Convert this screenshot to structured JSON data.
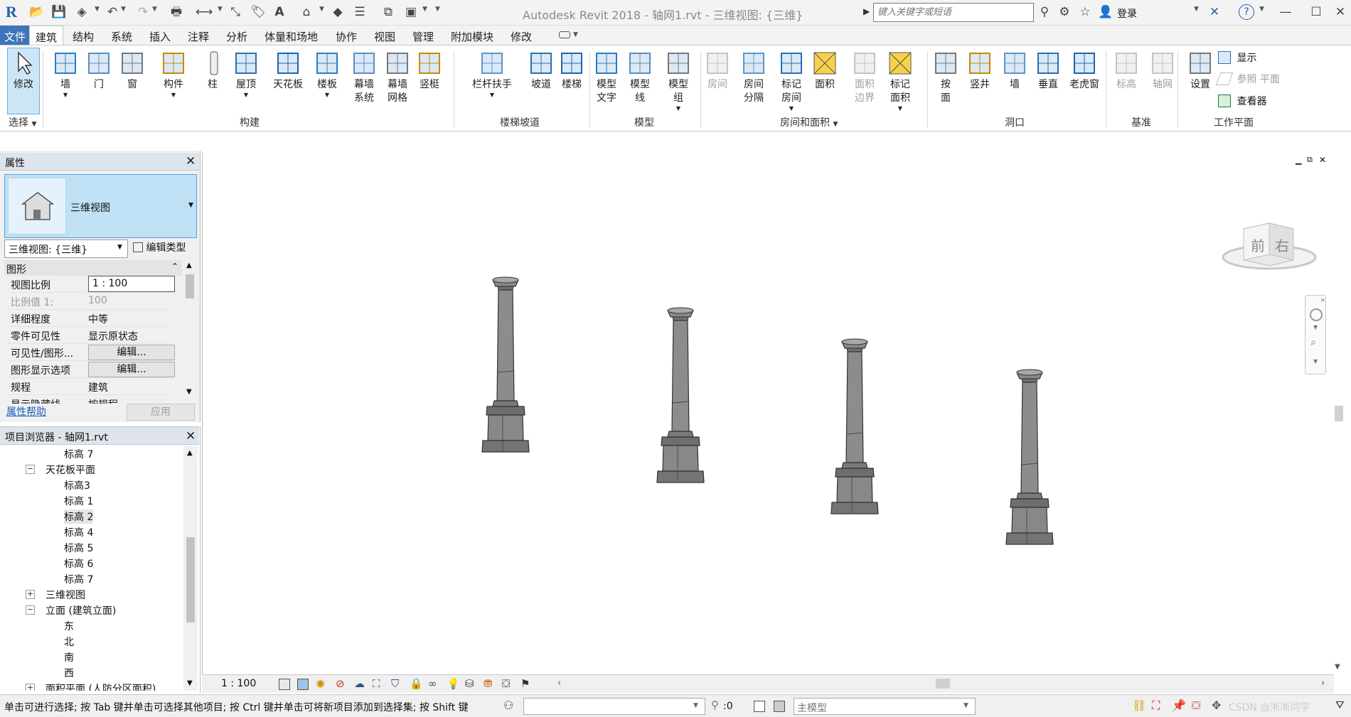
{
  "app": {
    "title": "Autodesk Revit 2018 -    轴网1.rvt - 三维视图: {三维}",
    "logo": "R",
    "search_placeholder": "键入关键字或短语",
    "login": "登录",
    "accent_color": "#3f74b8",
    "help": "?"
  },
  "tabs": [
    {
      "label": "文件"
    },
    {
      "label": "建筑"
    },
    {
      "label": "结构"
    },
    {
      "label": "系统"
    },
    {
      "label": "插入"
    },
    {
      "label": "注释"
    },
    {
      "label": "分析"
    },
    {
      "label": "体量和场地"
    },
    {
      "label": "协作"
    },
    {
      "label": "视图"
    },
    {
      "label": "管理"
    },
    {
      "label": "附加模块"
    },
    {
      "label": "修改"
    }
  ],
  "ribbon": {
    "buttons": [
      {
        "l1": "修改",
        "l2": "",
        "icon": "cursor-icon"
      },
      {
        "l1": "墙",
        "l2": "",
        "icon": "wall-icon"
      },
      {
        "l1": "门",
        "l2": "",
        "icon": "door-icon"
      },
      {
        "l1": "窗",
        "l2": "",
        "icon": "window-icon"
      },
      {
        "l1": "构件",
        "l2": "",
        "icon": "component-icon"
      },
      {
        "l1": "柱",
        "l2": "",
        "icon": "column-icon"
      },
      {
        "l1": "屋顶",
        "l2": "",
        "icon": "roof-icon"
      },
      {
        "l1": "天花板",
        "l2": "",
        "icon": "ceiling-icon"
      },
      {
        "l1": "楼板",
        "l2": "",
        "icon": "floor-icon"
      },
      {
        "l1": "幕墙",
        "l2": "系统",
        "icon": "curtain-system-icon"
      },
      {
        "l1": "幕墙",
        "l2": "网格",
        "icon": "curtain-grid-icon"
      },
      {
        "l1": "竖梃",
        "l2": "",
        "icon": "mullion-icon"
      },
      {
        "l1": "栏杆扶手",
        "l2": "",
        "icon": "railing-icon"
      },
      {
        "l1": "坡道",
        "l2": "",
        "icon": "ramp-icon"
      },
      {
        "l1": "楼梯",
        "l2": "",
        "icon": "stair-icon"
      },
      {
        "l1": "模型",
        "l2": "文字",
        "icon": "model-text-icon"
      },
      {
        "l1": "模型",
        "l2": "线",
        "icon": "model-line-icon"
      },
      {
        "l1": "模型",
        "l2": "组",
        "icon": "model-group-icon"
      },
      {
        "l1": "房间",
        "l2": "",
        "icon": "room-icon"
      },
      {
        "l1": "房间",
        "l2": "分隔",
        "icon": "room-separator-icon"
      },
      {
        "l1": "标记",
        "l2": "房间",
        "icon": "tag-room-icon"
      },
      {
        "l1": "面积",
        "l2": "",
        "icon": "area-icon"
      },
      {
        "l1": "面积",
        "l2": "边界",
        "icon": "area-boundary-icon"
      },
      {
        "l1": "标记",
        "l2": "面积",
        "icon": "tag-area-icon"
      },
      {
        "l1": "按",
        "l2": "面",
        "icon": "by-face-icon"
      },
      {
        "l1": "竖井",
        "l2": "",
        "icon": "shaft-icon"
      },
      {
        "l1": "墙",
        "l2": "",
        "icon": "wall-opening-icon"
      },
      {
        "l1": "垂直",
        "l2": "",
        "icon": "vertical-opening-icon"
      },
      {
        "l1": "老虎窗",
        "l2": "",
        "icon": "dormer-icon"
      },
      {
        "l1": "标高",
        "l2": "",
        "icon": "level-icon"
      },
      {
        "l1": "轴网",
        "l2": "",
        "icon": "grid-icon"
      },
      {
        "l1": "设置",
        "l2": "",
        "icon": "workplane-set-icon"
      }
    ],
    "side_buttons": [
      {
        "label": "显示",
        "icon": "show-icon"
      },
      {
        "label": "参照 平面",
        "icon": "ref-plane-icon"
      },
      {
        "label": "查看器",
        "icon": "viewer-icon"
      }
    ],
    "panels": [
      {
        "label": "选择"
      },
      {
        "label": "构建"
      },
      {
        "label": "楼梯坡道"
      },
      {
        "label": "模型"
      },
      {
        "label": "房间和面积"
      },
      {
        "label": "洞口"
      },
      {
        "label": "基准"
      },
      {
        "label": "工作平面"
      }
    ]
  },
  "properties": {
    "title": "属性",
    "type_name": "三维视图",
    "view_selector": "三维视图: {三维}",
    "edit_type": "编辑类型",
    "group": "图形",
    "rows": [
      {
        "label": "视图比例",
        "value": "1 : 100"
      },
      {
        "label": "比例值 1:",
        "value": "100"
      },
      {
        "label": "详细程度",
        "value": "中等"
      },
      {
        "label": "零件可见性",
        "value": "显示原状态"
      },
      {
        "label": "可见性/图形...",
        "value": "编辑..."
      },
      {
        "label": "图形显示选项",
        "value": "编辑..."
      },
      {
        "label": "规程",
        "value": "建筑"
      },
      {
        "label": "显示隐藏线",
        "value": "按规程"
      }
    ],
    "help_link": "属性帮助",
    "apply": "应用"
  },
  "browser": {
    "title": "项目浏览器 - 轴网1.rvt",
    "items": [
      {
        "text": "标高 7",
        "level": 2,
        "exp": ""
      },
      {
        "text": "天花板平面",
        "level": 1,
        "exp": "−"
      },
      {
        "text": "标高3",
        "level": 2,
        "exp": ""
      },
      {
        "text": "标高 1",
        "level": 2,
        "exp": ""
      },
      {
        "text": "标高 2",
        "level": 2,
        "exp": ""
      },
      {
        "text": "标高 4",
        "level": 2,
        "exp": ""
      },
      {
        "text": "标高 5",
        "level": 2,
        "exp": ""
      },
      {
        "text": "标高 6",
        "level": 2,
        "exp": ""
      },
      {
        "text": "标高 7",
        "level": 2,
        "exp": ""
      },
      {
        "text": "三维视图",
        "level": 1,
        "exp": "+"
      },
      {
        "text": "立面 (建筑立面)",
        "level": 1,
        "exp": "−"
      },
      {
        "text": "东",
        "level": 2,
        "exp": ""
      },
      {
        "text": "北",
        "level": 2,
        "exp": ""
      },
      {
        "text": "南",
        "level": 2,
        "exp": ""
      },
      {
        "text": "西",
        "level": 2,
        "exp": ""
      },
      {
        "text": "面积平面 (人防分区面积)",
        "level": 1,
        "exp": "+"
      }
    ]
  },
  "viewcube": {
    "front": "前",
    "right": "右"
  },
  "viewbar": {
    "scale": "1 : 100"
  },
  "status": {
    "message": "单击可进行选择; 按 Tab 键并单击可选择其他项目; 按 Ctrl 键并单击可将新项目添加到选择集; 按 Shift 键",
    "count": ":0",
    "model": "主模型",
    "watermark": "CSDN @淅淅同学"
  }
}
